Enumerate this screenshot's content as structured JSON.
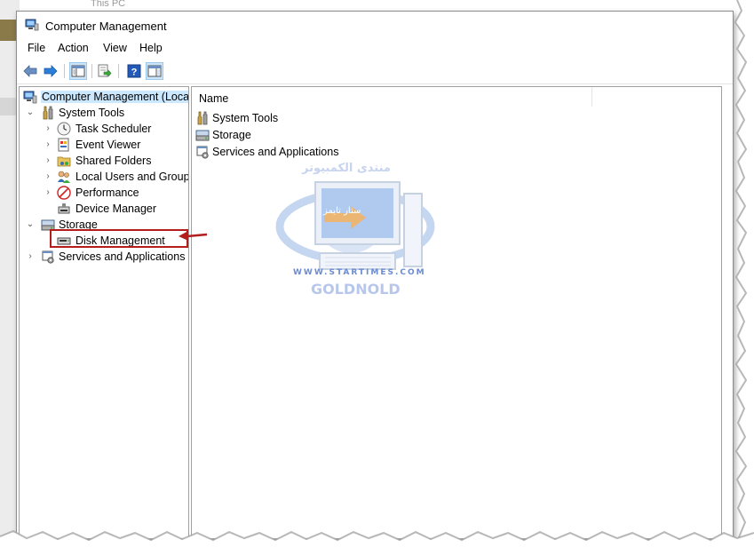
{
  "background": {
    "window_tab_text": "This PC"
  },
  "window": {
    "title": "Computer Management"
  },
  "menu": {
    "items": [
      "File",
      "Action",
      "View",
      "Help"
    ]
  },
  "toolbar": {
    "buttons": [
      "back-arrow-icon",
      "forward-arrow-icon",
      "show-hide-console-tree-icon",
      "export-list-icon",
      "help-icon",
      "show-hide-action-pane-icon"
    ]
  },
  "tree": {
    "root": "Computer Management (Local",
    "system_tools": "System Tools",
    "task_scheduler": "Task Scheduler",
    "event_viewer": "Event Viewer",
    "shared_folders": "Shared Folders",
    "local_users": "Local Users and Groups",
    "performance": "Performance",
    "device_manager": "Device Manager",
    "storage": "Storage",
    "disk_management": "Disk Management",
    "services_apps": "Services and Applications"
  },
  "list": {
    "column_name": "Name",
    "items": [
      "System Tools",
      "Storage",
      "Services and Applications"
    ]
  },
  "watermark": {
    "arabic": "منتدى الكمبيوتر",
    "domain": "WWW.STARTIMES.COM",
    "brand": "GOLDNOLD",
    "badge": "ستار تايمز"
  },
  "colors": {
    "selection": "#cce8ff",
    "annotation_red": "#b51c1c",
    "toolbar_pressed": "#cce4f7"
  }
}
